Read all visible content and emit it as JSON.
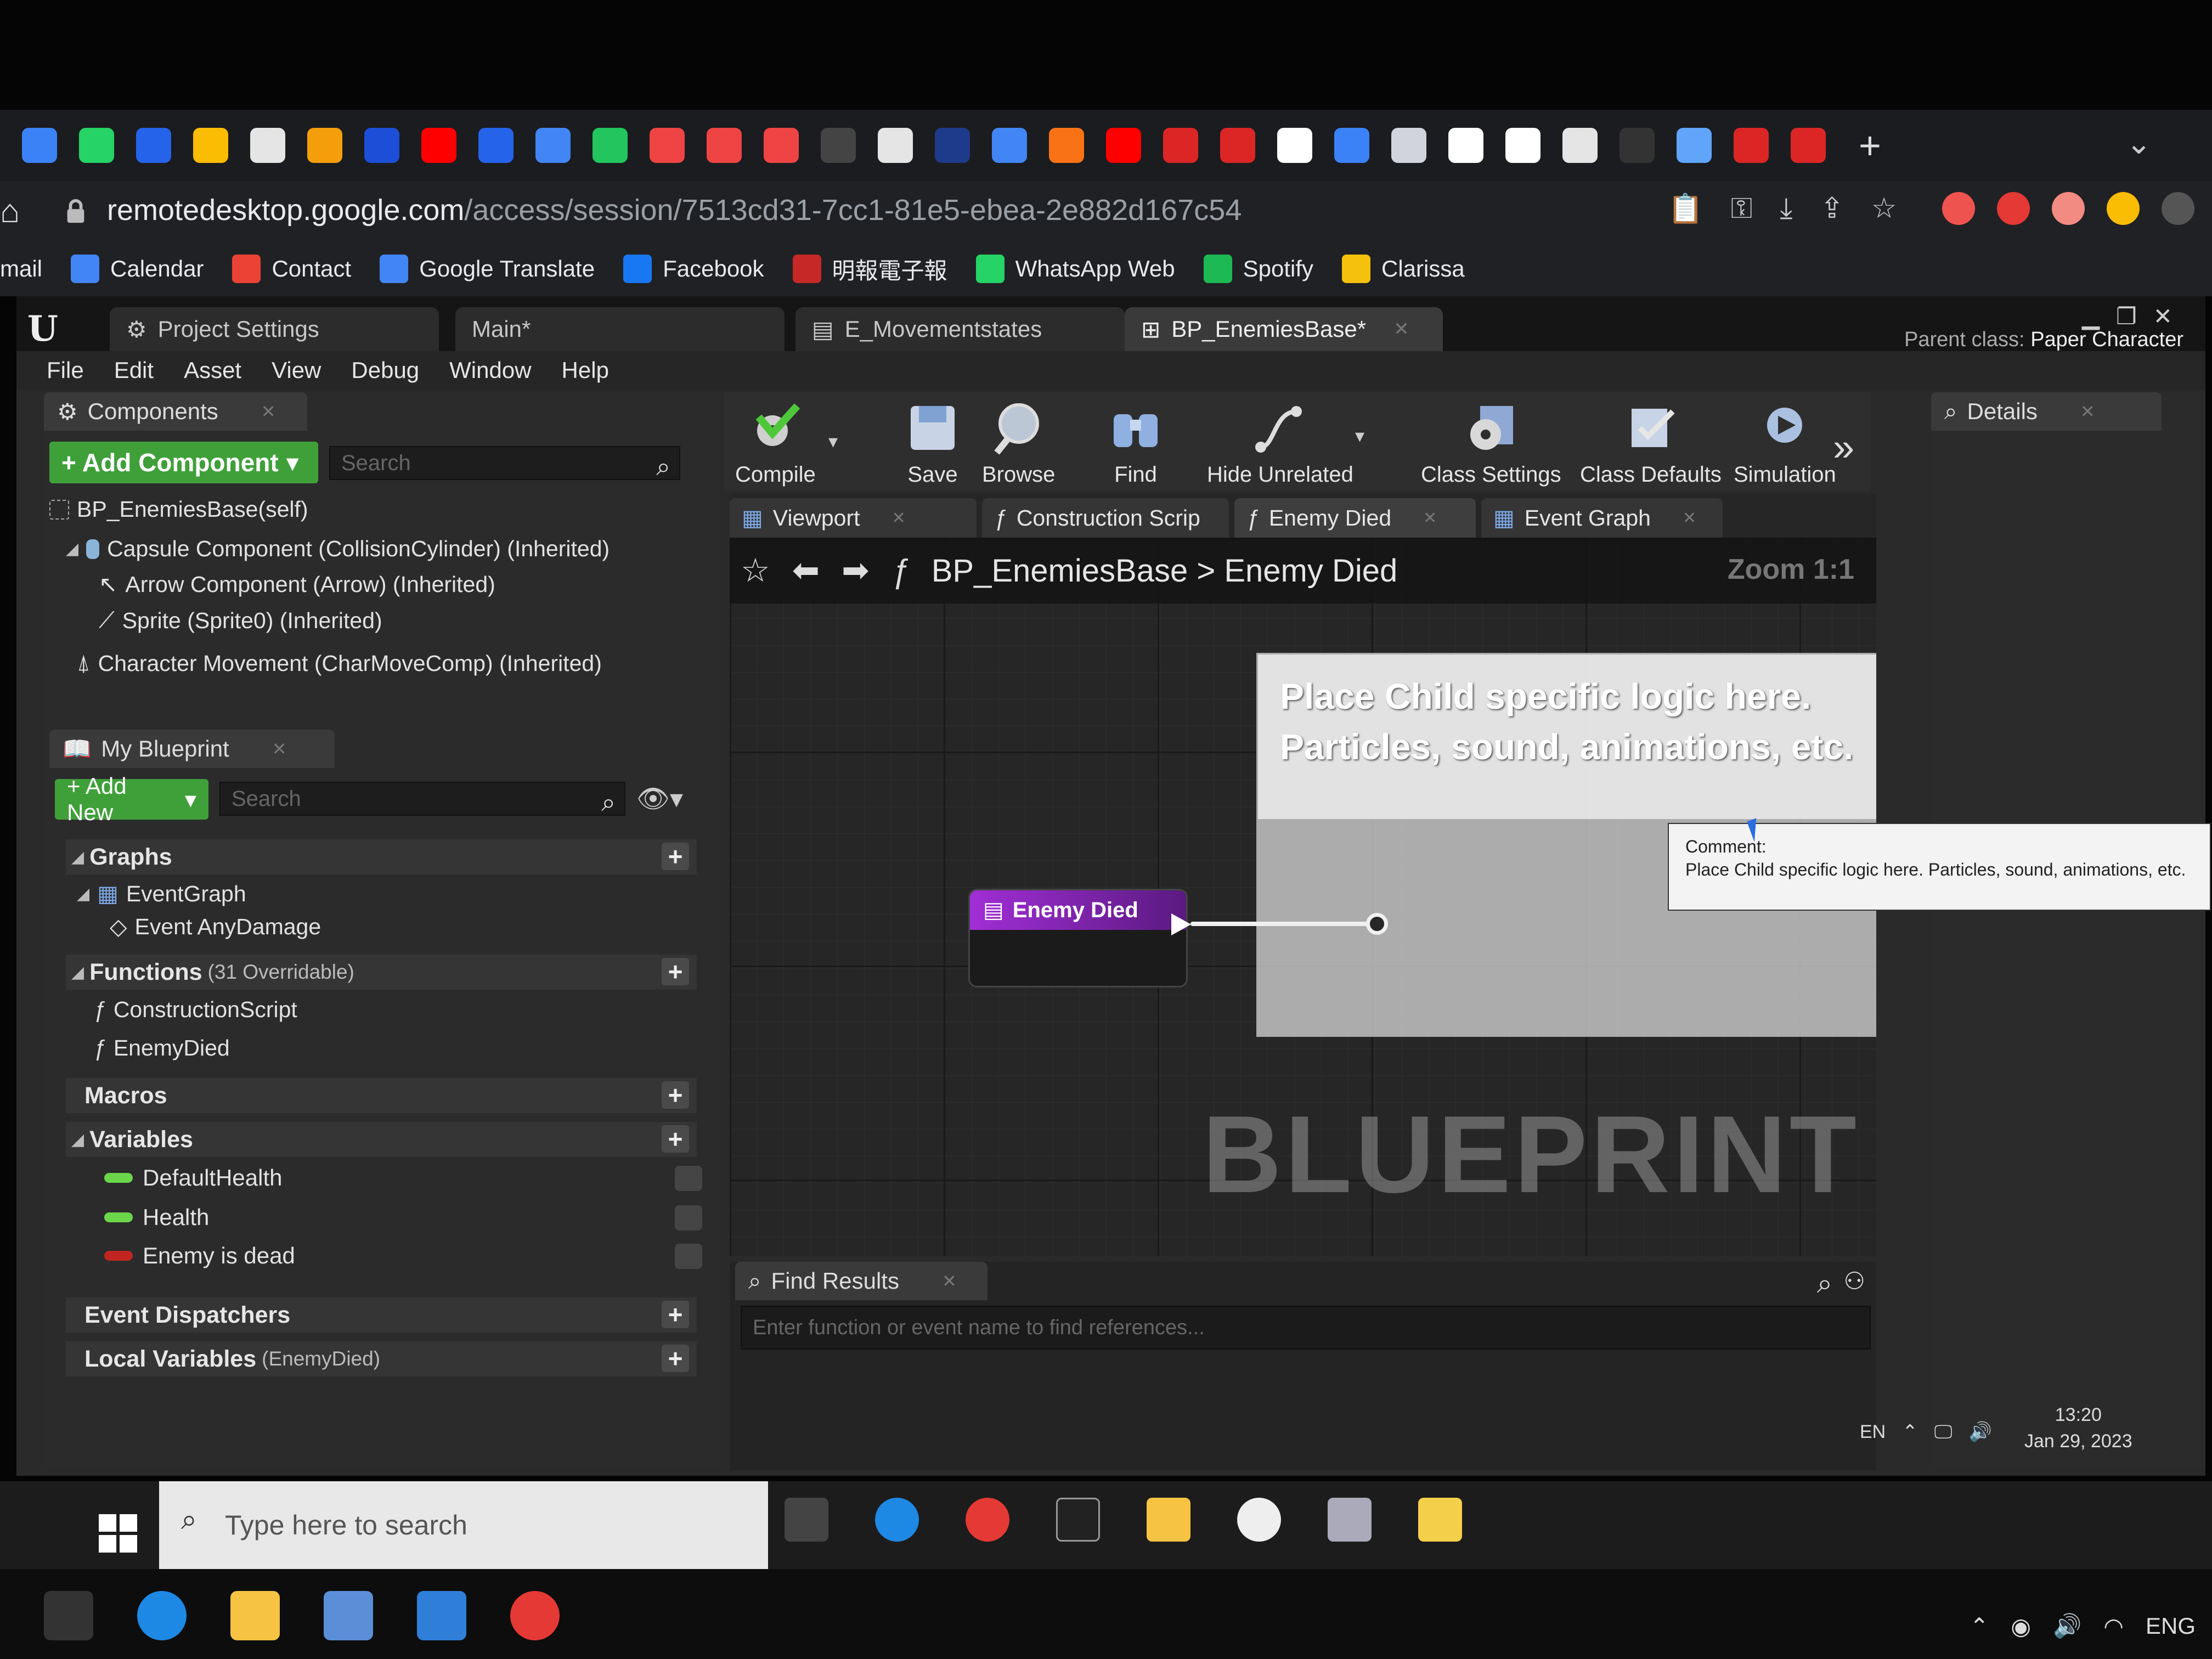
{
  "browser": {
    "url_host": "remotedesktop.google.com",
    "url_path": "/access/session/7513cd31-7cc1-81e5-ebea-2e882d167c54",
    "bookmarks": [
      {
        "label": "mail",
        "icon": "gmail-icon"
      },
      {
        "label": "Calendar",
        "icon": "calendar-icon"
      },
      {
        "label": "Contact",
        "icon": "gmail-icon"
      },
      {
        "label": "Google Translate",
        "icon": "translate-icon"
      },
      {
        "label": "Facebook",
        "icon": "facebook-icon"
      },
      {
        "label": "明報電子報",
        "icon": "news-icon"
      },
      {
        "label": "WhatsApp Web",
        "icon": "whatsapp-icon"
      },
      {
        "label": "Spotify",
        "icon": "spotify-icon"
      },
      {
        "label": "Clarissa",
        "icon": "folder-icon"
      }
    ],
    "favicon_colors": [
      "#3b82f6",
      "#25d366",
      "#2563eb",
      "#fbbc04",
      "#e5e5e5",
      "#f59e0b",
      "#1d4ed8",
      "#ff0000",
      "#2563eb",
      "#4285f4",
      "#22c55e",
      "#ef4444",
      "#ef4444",
      "#ef4444",
      "#444444",
      "#e5e5e5",
      "#1e3a8a",
      "#4285f4",
      "#f97316",
      "#ff0000",
      "#dc2626",
      "#dc2626",
      "#ffffff",
      "#3b82f6",
      "#d1d5db",
      "#ffffff",
      "#ffffff",
      "#e5e5e5",
      "#333333",
      "#60a5fa",
      "#dc2626",
      "#dc2626"
    ]
  },
  "ue": {
    "tabs": [
      {
        "label": "Project Settings"
      },
      {
        "label": "Main*"
      },
      {
        "label": "E_Movementstates"
      },
      {
        "label": "BP_EnemiesBase*"
      }
    ],
    "parent_class_label": "Parent class:",
    "parent_class_value": "Paper Character",
    "menu": [
      "File",
      "Edit",
      "Asset",
      "View",
      "Debug",
      "Window",
      "Help"
    ],
    "components": {
      "tab_label": "Components",
      "add_button": "+ Add Component",
      "search_placeholder": "Search",
      "self": "BP_EnemiesBase(self)",
      "items": [
        "Capsule Component (CollisionCylinder) (Inherited)",
        "Arrow Component (Arrow) (Inherited)",
        "Sprite (Sprite0) (Inherited)",
        "Character Movement (CharMoveComp) (Inherited)"
      ]
    },
    "my_blueprint": {
      "tab_label": "My Blueprint",
      "add_button": "+ Add New",
      "search_placeholder": "Search",
      "graphs_header": "Graphs",
      "event_graph": "EventGraph",
      "event_any_damage": "Event AnyDamage",
      "functions_header": "Functions",
      "functions_sub": "(31 Overridable)",
      "construction_script": "ConstructionScript",
      "enemy_died": "EnemyDied",
      "macros_header": "Macros",
      "variables_header": "Variables",
      "variables": [
        {
          "name": "DefaultHealth",
          "color": "#6bd64a"
        },
        {
          "name": "Health",
          "color": "#6bd64a"
        },
        {
          "name": "Enemy is dead",
          "color": "#c0261f"
        }
      ],
      "dispatchers_header": "Event Dispatchers",
      "local_vars_header": "Local Variables",
      "local_vars_sub": "(EnemyDied)"
    },
    "toolbar": {
      "compile": "Compile",
      "save": "Save",
      "browse": "Browse",
      "find": "Find",
      "hide_unrelated": "Hide Unrelated",
      "class_settings": "Class Settings",
      "class_defaults": "Class Defaults",
      "simulation": "Simulation"
    },
    "graph_tabs": [
      "Viewport",
      "Construction Scrip",
      "Enemy Died",
      "Event Graph"
    ],
    "breadcrumb_root": "BP_EnemiesBase",
    "breadcrumb_leaf": "Enemy Died",
    "zoom": "Zoom 1:1",
    "comment_text": "Place Child specific logic here. Particles, sound, animations, etc.",
    "node_title": "Enemy Died",
    "watermark": "BLUEPRINT",
    "tooltip_title": "Comment:",
    "tooltip_body": "Place Child specific logic here. Particles, sound, animations, etc.",
    "find_tab": "Find Results",
    "find_placeholder": "Enter function or event name to find references...",
    "details_tab": "Details"
  },
  "remote_taskbar": {
    "lang": "EN",
    "time": "13:20",
    "date": "Jan 29, 2023"
  },
  "local_taskbar": {
    "search_placeholder": "Type here to search",
    "lang": "ENG"
  }
}
